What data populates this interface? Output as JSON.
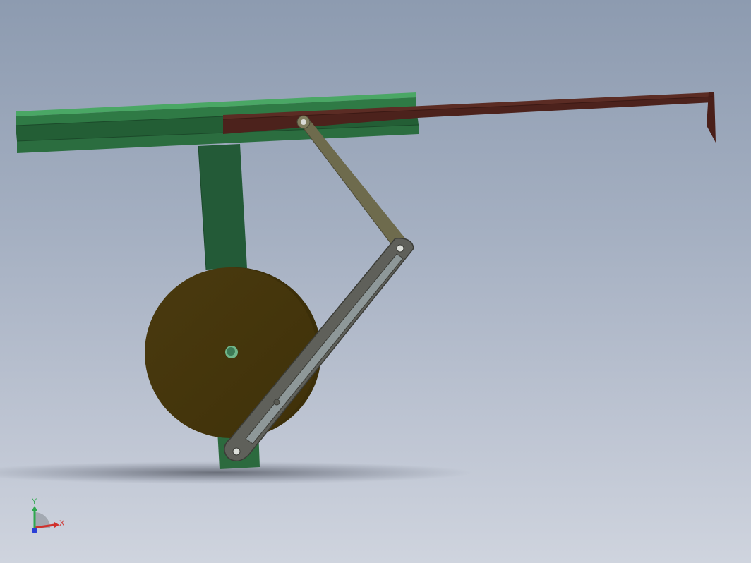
{
  "scene": {
    "colors": {
      "background_top": "#8d9bb0",
      "background_bottom": "#cfd4de",
      "frame_green": "#2a6b3e",
      "frame_green_light": "#4aa765",
      "slider_red": "#5a2a22",
      "disc_olive": "#4d3b10",
      "link_gray": "#6b6a55",
      "slotted_link_gray": "#5d5e57"
    },
    "parts": [
      "frame",
      "slider",
      "crank-disc",
      "connecting-rod",
      "slotted-lever"
    ]
  },
  "triad": {
    "x_label": "X",
    "y_label": "Y",
    "x_color": "#d0312d",
    "y_color": "#2fa84f",
    "z_color": "#2a3fd6"
  }
}
